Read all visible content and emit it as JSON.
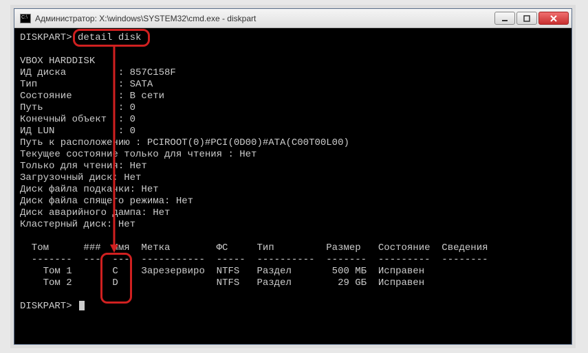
{
  "window": {
    "title": "Администратор: X:\\windows\\SYSTEM32\\cmd.exe - diskpart"
  },
  "prompt": "DISKPART>",
  "command": "detail disk",
  "details": {
    "device": "VBOX HARDDISK",
    "lines": [
      "ИД диска         : 857C158F",
      "Тип              : SATA",
      "Состояние        : В сети",
      "Путь             : 0",
      "Конечный объект  : 0",
      "ИД LUN           : 0",
      "Путь к расположению : PCIROOT(0)#PCI(0D00)#ATA(C00T00L00)",
      "Текущее состояние только для чтения : Нет",
      "Только для чтения: Нет",
      "Загрузочный диск: Нет",
      "Диск файла подкачки: Нет",
      "Диск файла спящего режима: Нет",
      "Диск аварийного дампа: Нет",
      "Кластерный диск: Нет"
    ]
  },
  "chart_data": {
    "type": "table",
    "columns": [
      "Том",
      "###",
      "Имя",
      "Метка",
      "ФС",
      "Тип",
      "Размер",
      "Состояние",
      "Сведения"
    ],
    "rows": [
      {
        "tom": "Том 1",
        "num": "",
        "name": "C",
        "label": "Зарезервиро",
        "fs": "NTFS",
        "type": "Раздел",
        "size": "500 МБ",
        "status": "Исправен",
        "info": ""
      },
      {
        "tom": "Том 2",
        "num": "",
        "name": "D",
        "label": "",
        "fs": "NTFS",
        "type": "Раздел",
        "size": "29 GБ",
        "status": "Исправен",
        "info": ""
      }
    ]
  },
  "table": {
    "header": "  Том      ###  Имя  Метка        ФС     Тип         Размер   Состояние  Сведения",
    "sep": "  -------  ---  ---  -----------  -----  ----------  -------  ---------  --------",
    "r1": "    Том 1       C    Зарезервиро  NTFS   Раздел       500 МБ  Исправен",
    "r2": "    Том 2       D                 NTFS   Раздел        29 GБ  Исправен"
  }
}
